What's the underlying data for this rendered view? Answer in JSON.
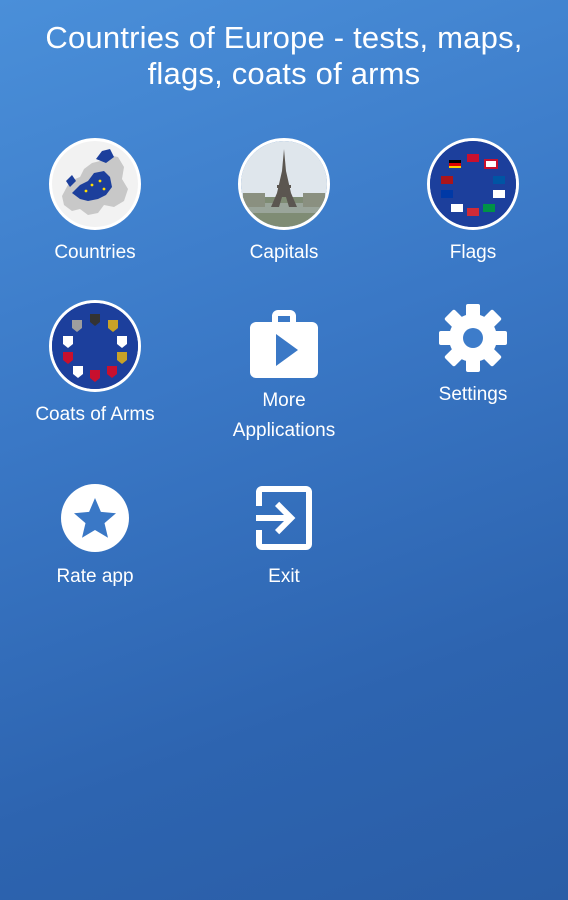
{
  "app": {
    "title": "Countries of Europe - tests, maps, flags, coats of arms"
  },
  "menu": {
    "countries": {
      "label": "Countries",
      "icon": "europe-map-icon"
    },
    "capitals": {
      "label": "Capitals",
      "icon": "eiffel-tower-photo-icon"
    },
    "flags": {
      "label": "Flags",
      "icon": "flags-circle-icon"
    },
    "coats_of_arms": {
      "label": "Coats of Arms",
      "icon": "coats-of-arms-circle-icon"
    },
    "more_applications": {
      "label_line1": "More",
      "label_line2": "Applications",
      "icon": "play-store-bag-icon"
    },
    "settings": {
      "label": "Settings",
      "icon": "gear-icon"
    },
    "rate_app": {
      "label": "Rate app",
      "icon": "star-icon"
    },
    "exit": {
      "label": "Exit",
      "icon": "exit-icon"
    }
  },
  "colors": {
    "background_top": "#4a8fd9",
    "background_bottom": "#2a5da6",
    "eu_blue": "#1c3f9c",
    "text": "#ffffff"
  }
}
